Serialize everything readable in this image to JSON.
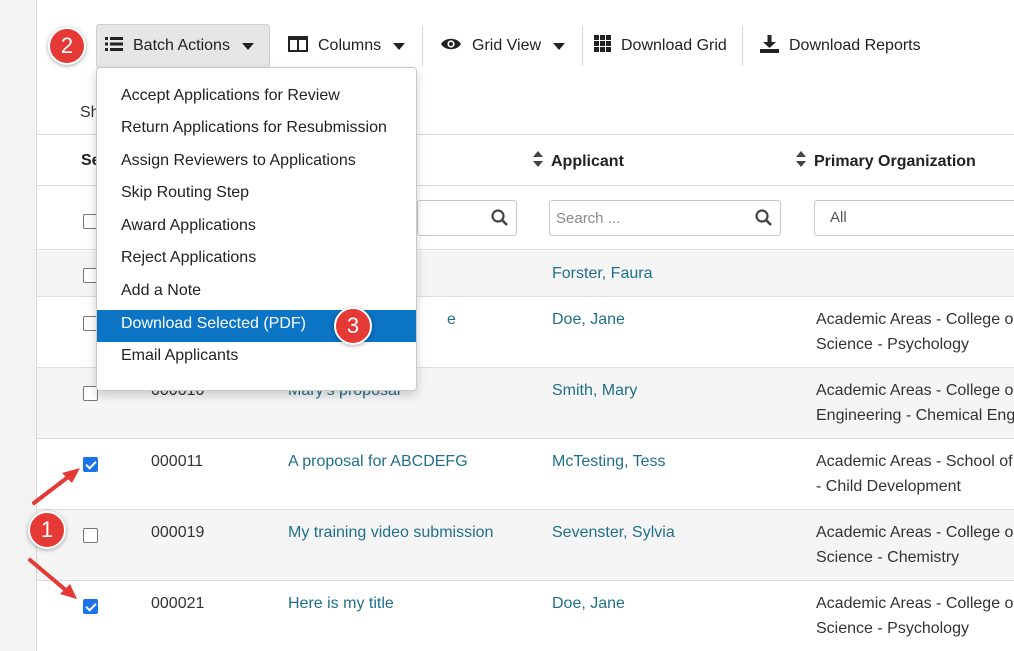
{
  "toolbar": {
    "batch_actions": "Batch Actions",
    "columns": "Columns",
    "grid_view": "Grid View",
    "download_grid": "Download Grid",
    "download_reports": "Download Reports"
  },
  "show_text": "Sh",
  "select_header": "Se",
  "columns_header": {
    "applicant": "Applicant",
    "primary_org": "Primary Organization"
  },
  "filters": {
    "applicant_placeholder": "Search ...",
    "primary_org_selected": "All"
  },
  "batch_menu": [
    "Accept Applications for Review",
    "Return Applications for Resubmission",
    "Assign Reviewers to Applications",
    "Skip Routing Step",
    "Award Applications",
    "Reject Applications",
    "Add a Note",
    "Download Selected (PDF)",
    "Email Applicants"
  ],
  "rows": [
    {
      "id": "",
      "title": "",
      "applicant": "Forster, Faura",
      "org1": "",
      "org2": "",
      "checked": false
    },
    {
      "id": "",
      "title": "e",
      "applicant": "Doe, Jane",
      "org1": "Academic Areas - College o",
      "org2": "Science - Psychology",
      "checked": false
    },
    {
      "id": "000010",
      "title": "Mary's proposal",
      "applicant": "Smith, Mary",
      "org1": "Academic Areas - College o",
      "org2": "Engineering - Chemical Eng",
      "checked": false
    },
    {
      "id": "000011",
      "title": "A proposal for ABCDEFG",
      "applicant": "McTesting, Tess",
      "org1": "Academic Areas - School of",
      "org2": "- Child Development",
      "checked": true
    },
    {
      "id": "000019",
      "title": "My training video submission",
      "applicant": "Sevenster, Sylvia",
      "org1": "Academic Areas - College o",
      "org2": "Science - Chemistry",
      "checked": false
    },
    {
      "id": "000021",
      "title": "Here is my title",
      "applicant": "Doe, Jane",
      "org1": "Academic Areas - College o",
      "org2": "Science - Psychology",
      "checked": true
    }
  ],
  "callouts": [
    "1",
    "2",
    "3"
  ],
  "colors": {
    "link": "#1f6f8b",
    "menu_highlight": "#0b74c4",
    "callout": "#e53935",
    "checkbox_checked": "#1a73e8"
  }
}
